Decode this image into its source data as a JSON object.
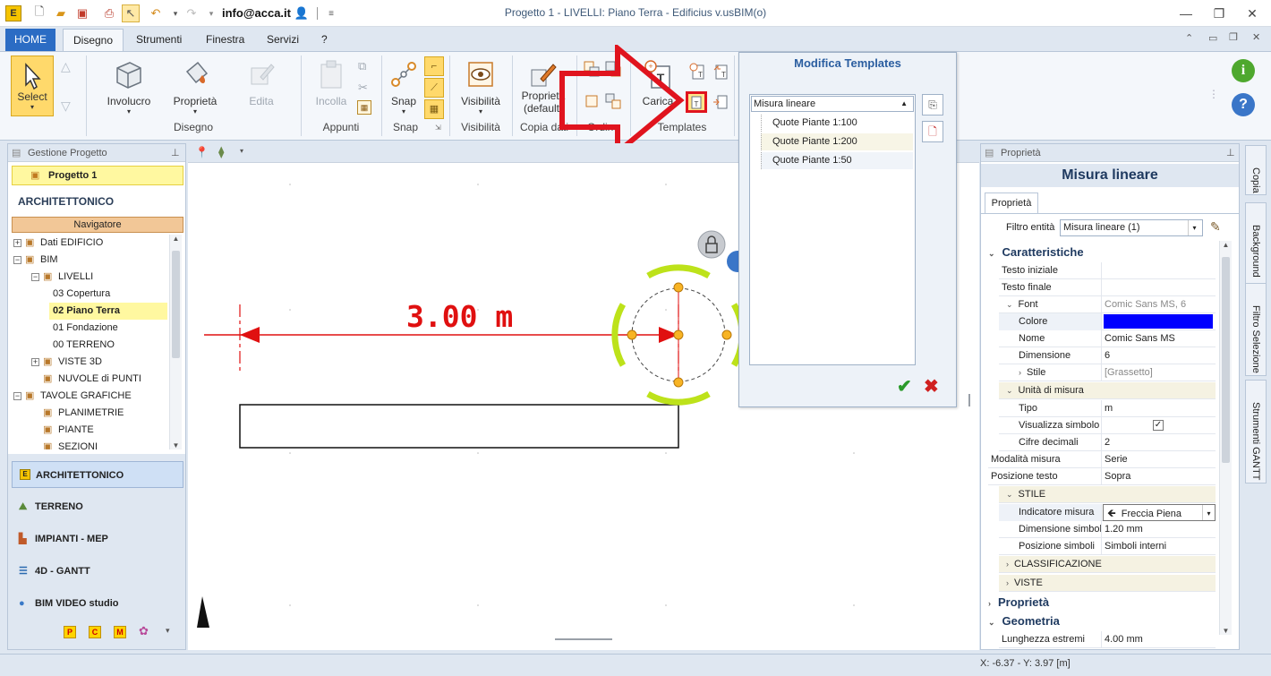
{
  "titlebar": {
    "account": "info@acca.it",
    "title": "Progetto 1 -  LIVELLI: Piano Terra - Edificius v.usBIM(o)"
  },
  "tabs": [
    {
      "label": "HOME"
    },
    {
      "label": "Disegno"
    },
    {
      "label": "Strumenti"
    },
    {
      "label": "Finestra"
    },
    {
      "label": "Servizi"
    },
    {
      "label": "?"
    }
  ],
  "ribbon": {
    "select": "Select",
    "involucro": "Involucro",
    "proprieta": "Proprietà",
    "edita": "Edita",
    "incolla": "Incolla",
    "snap": "Snap",
    "visibilita": "Visibilità",
    "proprieta_default": "Proprietà (default)",
    "carica": "Carica",
    "groups": {
      "disegno": "Disegno",
      "appunti": "Appunti",
      "snap": "Snap",
      "visibilita": "Visibilità",
      "copia": "Copia dati",
      "ordine": "Ordine",
      "templates": "Templates"
    }
  },
  "left_panel": {
    "header": "Gestione Progetto",
    "project": "Progetto 1",
    "section": "ARCHITETTONICO",
    "navigator": "Navigatore",
    "tree": [
      {
        "label": "Dati EDIFICIO",
        "level": 0,
        "expander": "+"
      },
      {
        "label": "BIM",
        "level": 0,
        "expander": "−"
      },
      {
        "label": "LIVELLI",
        "level": 1,
        "expander": "−"
      },
      {
        "label": "03 Copertura",
        "level": 2,
        "expander": ""
      },
      {
        "label": "02 Piano Terra",
        "level": 2,
        "expander": "",
        "selected": true
      },
      {
        "label": "01 Fondazione",
        "level": 2,
        "expander": ""
      },
      {
        "label": "00 TERRENO",
        "level": 2,
        "expander": ""
      },
      {
        "label": "VISTE 3D",
        "level": 1,
        "expander": "+"
      },
      {
        "label": "NUVOLE di PUNTI",
        "level": 1,
        "expander": ""
      },
      {
        "label": "TAVOLE GRAFICHE",
        "level": 0,
        "expander": "−"
      },
      {
        "label": "PLANIMETRIE",
        "level": 1,
        "expander": ""
      },
      {
        "label": "PIANTE",
        "level": 1,
        "expander": ""
      },
      {
        "label": "SEZIONI",
        "level": 1,
        "expander": ""
      }
    ],
    "nav_buttons": [
      {
        "label": "ARCHITETTONICO"
      },
      {
        "label": "TERRENO"
      },
      {
        "label": "IMPIANTI - MEP"
      },
      {
        "label": "4D - GANTT"
      },
      {
        "label": "BIM VIDEO studio"
      }
    ],
    "mini_buttons": [
      "P",
      "C",
      "M"
    ]
  },
  "canvas": {
    "dimension_text": "3.00 m"
  },
  "dialog": {
    "title": "Modifica Templates",
    "dropdown": "Misura lineare",
    "items": [
      "Quote Piante 1:100",
      "Quote Piante 1:200",
      "Quote Piante 1:50"
    ]
  },
  "properties": {
    "header": "Proprietà",
    "entity_title": "Misura lineare",
    "tab": "Proprietà",
    "filter_label": "Filtro entità",
    "filter_value": "Misura lineare (1)",
    "categories": {
      "caratteristiche": "Caratteristiche",
      "proprieta": "Proprietà",
      "geometria": "Geometria"
    },
    "rows": {
      "testo_iniziale": {
        "k": "Testo iniziale",
        "v": ""
      },
      "testo_finale": {
        "k": "Testo finale",
        "v": ""
      },
      "font": {
        "k": "Font",
        "v": "Comic Sans MS, 6"
      },
      "colore": {
        "k": "Colore",
        "v": ""
      },
      "nome": {
        "k": "Nome",
        "v": "Comic Sans MS"
      },
      "dimensione": {
        "k": "Dimensione",
        "v": "6"
      },
      "stile": {
        "k": "Stile",
        "v": "[Grassetto]"
      },
      "tipo": {
        "k": "Tipo",
        "v": "m"
      },
      "visualizza": {
        "k": "Visualizza simbolo",
        "v": ""
      },
      "cifre": {
        "k": "Cifre decimali",
        "v": "2"
      },
      "modalita": {
        "k": "Modalità misura",
        "v": "Serie"
      },
      "posizione": {
        "k": "Posizione testo",
        "v": "Sopra"
      },
      "indicatore": {
        "k": "Indicatore misura",
        "v": "Freccia Piena"
      },
      "dim_simboli": {
        "k": "Dimensione simboli",
        "v": "1.20 mm"
      },
      "pos_simboli": {
        "k": "Posizione simboli",
        "v": "Simboli interni"
      },
      "lunghezza": {
        "k": "Lunghezza estremi",
        "v": "4.00 mm"
      }
    },
    "subcats": {
      "unita": "Unità di misura",
      "stile": "STILE",
      "classificazione": "CLASSIFICAZIONE",
      "viste": "VISTE"
    },
    "color_value": "#0000ff"
  },
  "side_tabs": [
    "Copia",
    "Background",
    "Filtro Selezione",
    "Strumenti GANTT"
  ],
  "status": {
    "coords": "X: -6.37 - Y: 3.97 [m]"
  }
}
